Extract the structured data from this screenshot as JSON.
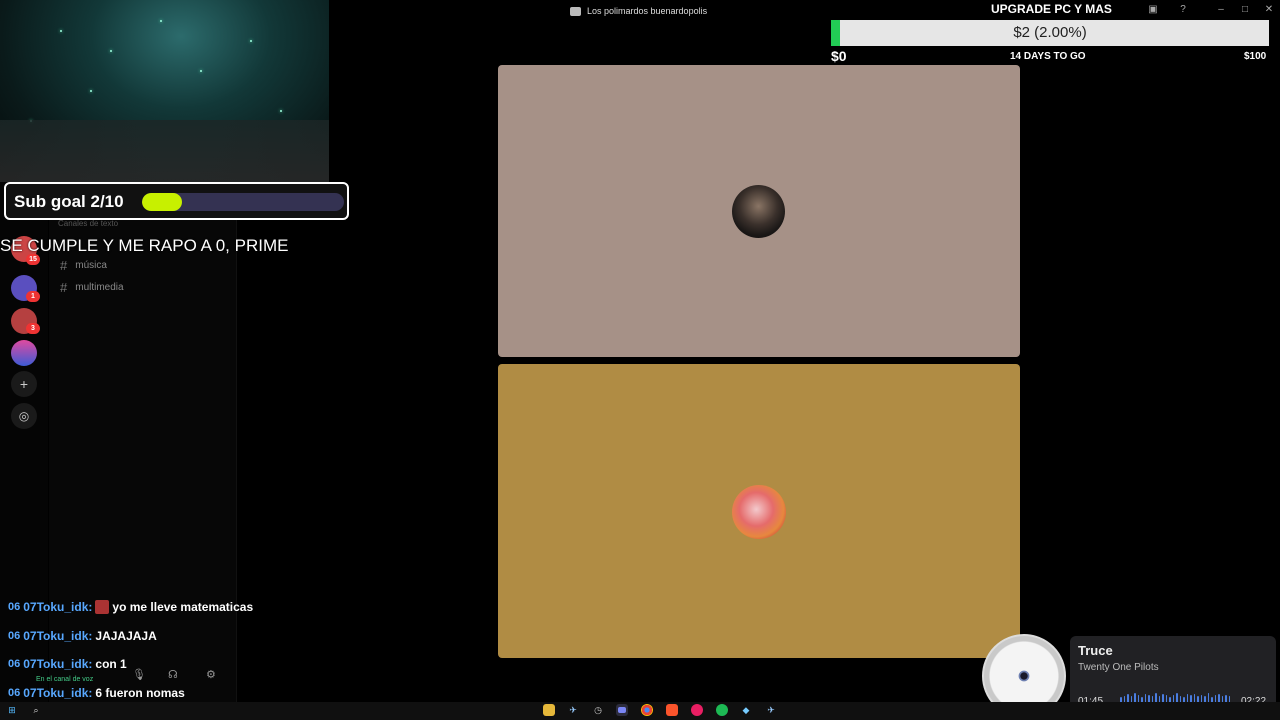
{
  "window": {
    "title": "Los polimardos buenardopolis"
  },
  "sub_goal": {
    "label": "Sub goal 2/10",
    "progress": 0.2,
    "note": "SE CUMPLE Y ME RAPO A 0, PRIME"
  },
  "donation": {
    "title": "UPGRADE PC Y MAS",
    "amount_text": "$2 (2.00%)",
    "progress": 0.02,
    "min": "$0",
    "days": "14 DAYS TO GO",
    "max": "$100",
    "fill_color": "#22cc55"
  },
  "channels": {
    "header": "Canales de texto",
    "items": [
      {
        "name": "música"
      },
      {
        "name": "multimedia"
      }
    ]
  },
  "servers": {
    "badges": [
      "15",
      "1",
      "3"
    ]
  },
  "chat": [
    {
      "badge": "06",
      "user": "07Toku_idk:",
      "message": "yo me lleve matematicas"
    },
    {
      "badge": "06",
      "user": "07Toku_idk:",
      "message": "JAJAJAJA"
    },
    {
      "badge": "06",
      "user": "07Toku_idk:",
      "message": "con 1"
    },
    {
      "badge": "06",
      "user": "07Toku_idk:",
      "message": "6 fueron nomas"
    }
  ],
  "voice": {
    "status": "En el canal de voz"
  },
  "music": {
    "title": "Truce",
    "artist": "Twenty One Pilots",
    "elapsed": "01:45",
    "duration": "02:22"
  },
  "colors": {
    "tile1": "#a69187",
    "tile2": "#b08c44",
    "accent": "#c7f000",
    "chat_name": "#58a8ff"
  },
  "icons": [
    "discord-icon",
    "windows-start-icon",
    "search-icon",
    "folder-icon",
    "chrome-icon",
    "spotify-icon",
    "steam-icon",
    "add-server-icon",
    "explore-icon",
    "headset-icon",
    "mic-icon",
    "settings-icon"
  ]
}
